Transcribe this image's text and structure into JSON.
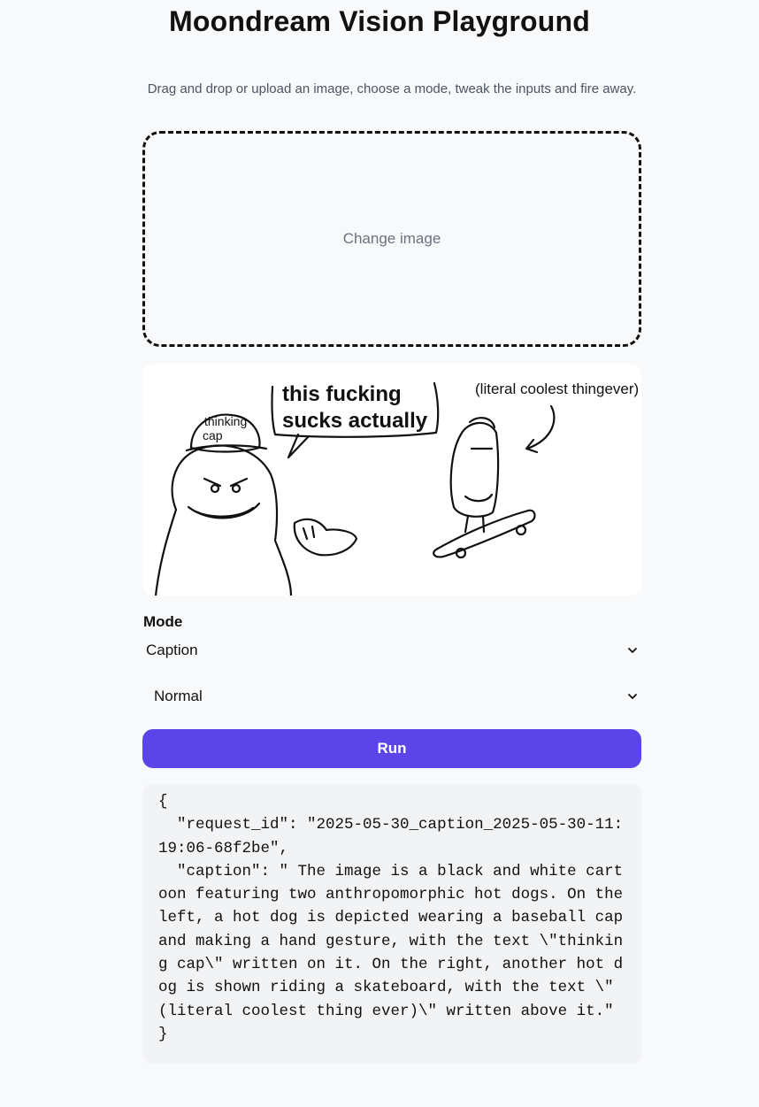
{
  "header": {
    "title": "Moondream Vision Playground",
    "subtitle": "Drag and drop or upload an image, choose a mode, tweak the inputs and fire away."
  },
  "dropzone": {
    "label": "Change image"
  },
  "preview": {
    "texts": {
      "speech": [
        "this fucking",
        "sucks actually"
      ],
      "cap": [
        "thinking",
        "cap"
      ],
      "coolest": "(literal coolest thingever)"
    }
  },
  "controls": {
    "mode_label": "Mode",
    "mode_value": "Caption",
    "length_value": "Normal",
    "run_label": "Run"
  },
  "output": {
    "json_text": "{\n  \"request_id\": \"2025-05-30_caption_2025-05-30-11:19:06-68f2be\",\n  \"caption\": \" The image is a black and white cartoon featuring two anthropomorphic hot dogs. On the left, a hot dog is depicted wearing a baseball cap and making a hand gesture, with the text \\\"thinking cap\\\" written on it. On the right, another hot dog is shown riding a skateboard, with the text \\\"(literal coolest thing ever)\\\" written above it.\"\n}"
  },
  "colors": {
    "accent": "#5b45e8",
    "background": "#f8f9fb",
    "output_bg": "#f2f3f5"
  },
  "icons": {
    "select_chevron": "chevron-down-icon"
  }
}
